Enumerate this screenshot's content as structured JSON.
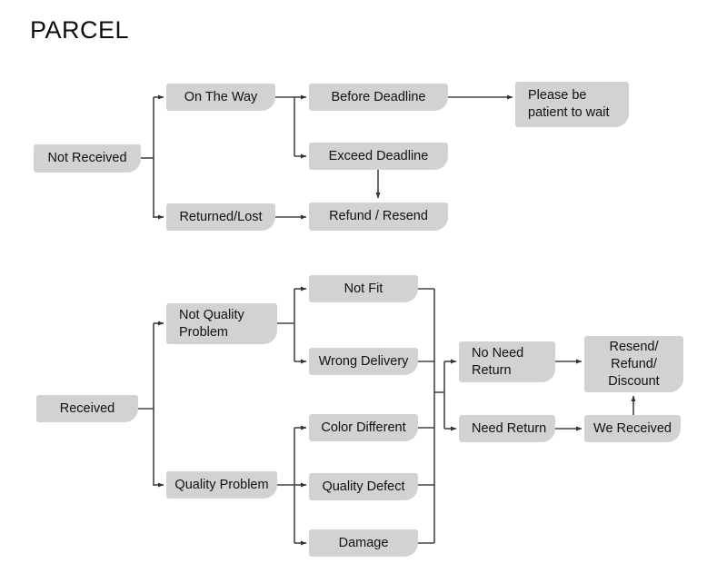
{
  "title": "PARCEL",
  "colors": {
    "node_fill": "#d2d2d2",
    "text": "#111111",
    "line": "#444444",
    "background": "#ffffff"
  },
  "diagram": {
    "type": "flowchart",
    "branches": [
      {
        "id": "not-received",
        "root": "Not Received",
        "children": [
          {
            "label": "On The Way",
            "children": [
              {
                "label": "Before Deadline",
                "children": [
                  {
                    "label": "Please be\npatient to wait"
                  }
                ]
              },
              {
                "label": "Exceed Deadline",
                "children": [
                  {
                    "label": "Refund / Resend"
                  }
                ]
              }
            ]
          },
          {
            "label": "Returned/Lost",
            "children": [
              {
                "label": "Refund / Resend"
              }
            ]
          }
        ]
      },
      {
        "id": "received",
        "root": "Received",
        "children": [
          {
            "label": "Not Quality\nProblem",
            "children": [
              {
                "label": "Not Fit"
              },
              {
                "label": "Wrong Delivery"
              }
            ]
          },
          {
            "label": "Quality Problem",
            "children": [
              {
                "label": "Color Different"
              },
              {
                "label": "Quality Defect"
              },
              {
                "label": "Damage"
              }
            ]
          }
        ],
        "merge": {
          "options": [
            "No Need\nReturn",
            "Need Return"
          ],
          "outcomes": [
            "Resend/\nRefund/\nDiscount",
            "We Received"
          ]
        }
      }
    ]
  },
  "nodes": {
    "not_received": "Not Received",
    "on_the_way": "On The Way",
    "returned_lost": "Returned/Lost",
    "before_deadline": "Before Deadline",
    "exceed_deadline": "Exceed Deadline",
    "refund_resend": "Refund / Resend",
    "please_wait": "Please be\npatient to wait",
    "received": "Received",
    "not_quality_problem": "Not Quality\nProblem",
    "quality_problem": "Quality Problem",
    "not_fit": "Not Fit",
    "wrong_delivery": "Wrong Delivery",
    "color_different": "Color Different",
    "quality_defect": "Quality Defect",
    "damage": "Damage",
    "no_need_return": "No Need\nReturn",
    "need_return": "Need Return",
    "resend_refund_discount": "Resend/\nRefund/\nDiscount",
    "we_received": "We Received"
  }
}
